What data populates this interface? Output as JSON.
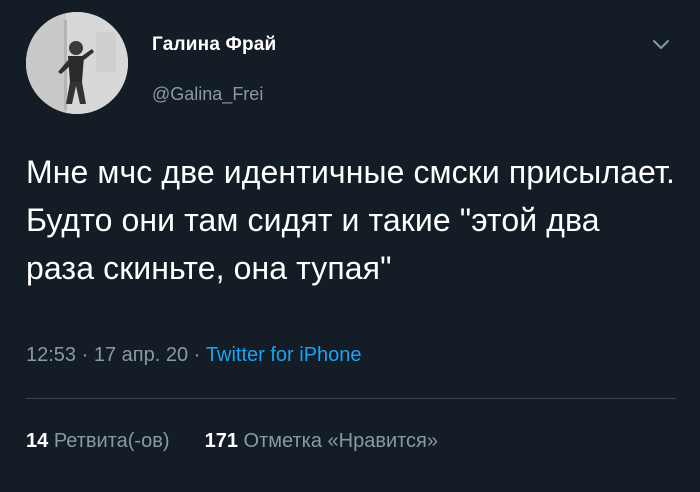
{
  "tweet": {
    "author": {
      "display_name": "Галина Фрай",
      "handle": "@Galina_Frei"
    },
    "text": "Мне мчс две идентичные смски присылает. Будто они там сидят и такие \"этой два раза скиньте, она тупая\"",
    "time": "12:53",
    "separator": "·",
    "date": "17 апр. 20",
    "source": "Twitter for iPhone",
    "stats": {
      "retweets_count": "14",
      "retweets_label": "Ретвита(-ов)",
      "likes_count": "171",
      "likes_label": "Отметка «Нравится»"
    },
    "icons": {
      "menu": "chevron-down-icon"
    },
    "colors": {
      "background": "#141d26",
      "text": "#ffffff",
      "secondary": "#8899a6",
      "link": "#1da1f2"
    }
  }
}
